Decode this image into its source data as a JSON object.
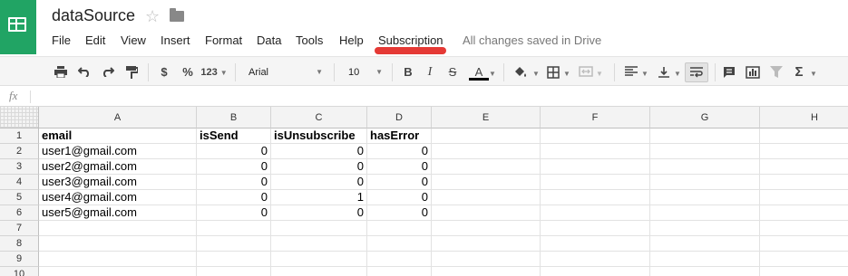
{
  "doc": {
    "title": "dataSource",
    "star_icon": "☆",
    "saved_status": "All changes saved in Drive"
  },
  "menu": [
    "File",
    "Edit",
    "View",
    "Insert",
    "Format",
    "Data",
    "Tools",
    "Help",
    "Subscription"
  ],
  "toolbar": {
    "currency": "$",
    "percent": "%",
    "more_formats": "123",
    "font": "Arial",
    "font_size": "10",
    "bold": "B",
    "italic": "I",
    "strike": "S",
    "text_color": "A"
  },
  "formula": {
    "label": "fx",
    "value": ""
  },
  "columns": [
    "A",
    "B",
    "C",
    "D",
    "E",
    "F",
    "G",
    "H"
  ],
  "row_numbers": [
    "1",
    "2",
    "3",
    "4",
    "5",
    "6",
    "7",
    "8",
    "9",
    "10"
  ],
  "cells": [
    [
      "email",
      "isSend",
      "isUnsubscribe",
      "hasError"
    ],
    [
      "user1@gmail.com",
      "0",
      "0",
      "0"
    ],
    [
      "user2@gmail.com",
      "0",
      "0",
      "0"
    ],
    [
      "user3@gmail.com",
      "0",
      "0",
      "0"
    ],
    [
      "user4@gmail.com",
      "0",
      "1",
      "0"
    ],
    [
      "user5@gmail.com",
      "0",
      "0",
      "0"
    ]
  ],
  "colors": {
    "brand": "#21a464",
    "highlight": "#e53935"
  }
}
